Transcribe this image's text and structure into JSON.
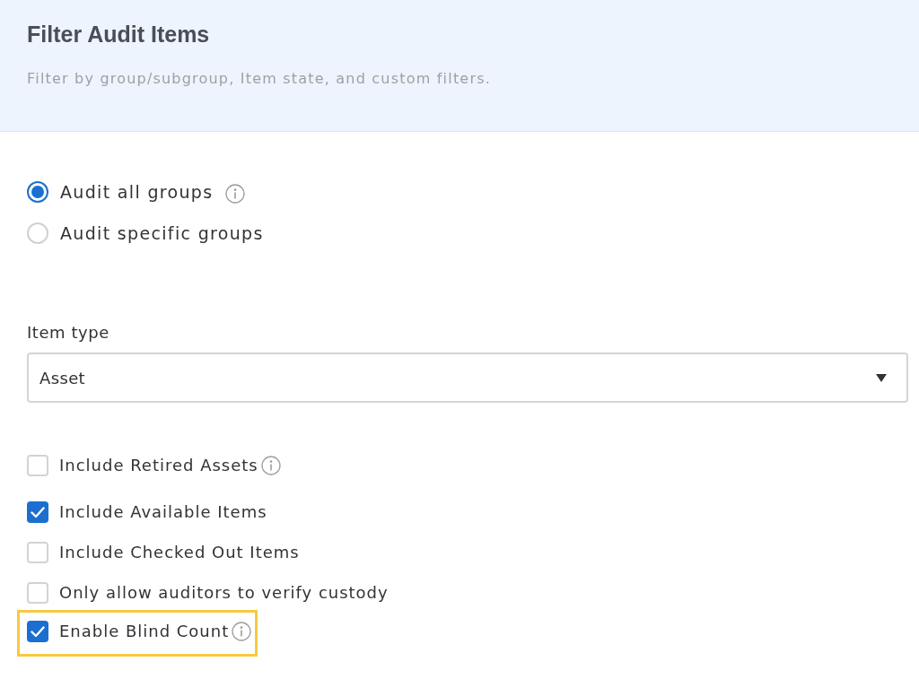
{
  "header": {
    "title": "Filter Audit Items",
    "subtitle": "Filter by group/subgroup, Item state, and custom filters."
  },
  "scope_options": [
    {
      "label": "Audit all groups",
      "selected": true,
      "info": true
    },
    {
      "label": "Audit specific groups",
      "selected": false,
      "info": false
    }
  ],
  "item_type": {
    "label": "Item type",
    "value": "Asset"
  },
  "checkboxes": [
    {
      "label": "Include Retired Assets",
      "checked": false,
      "info": true,
      "highlighted": false
    },
    {
      "label": "Include Available Items",
      "checked": true,
      "info": false,
      "highlighted": false
    },
    {
      "label": "Include Checked Out Items",
      "checked": false,
      "info": false,
      "highlighted": false
    },
    {
      "label": "Only allow auditors to verify custody",
      "checked": false,
      "info": false,
      "highlighted": false
    },
    {
      "label": "Enable Blind Count",
      "checked": true,
      "info": true,
      "highlighted": true
    }
  ]
}
